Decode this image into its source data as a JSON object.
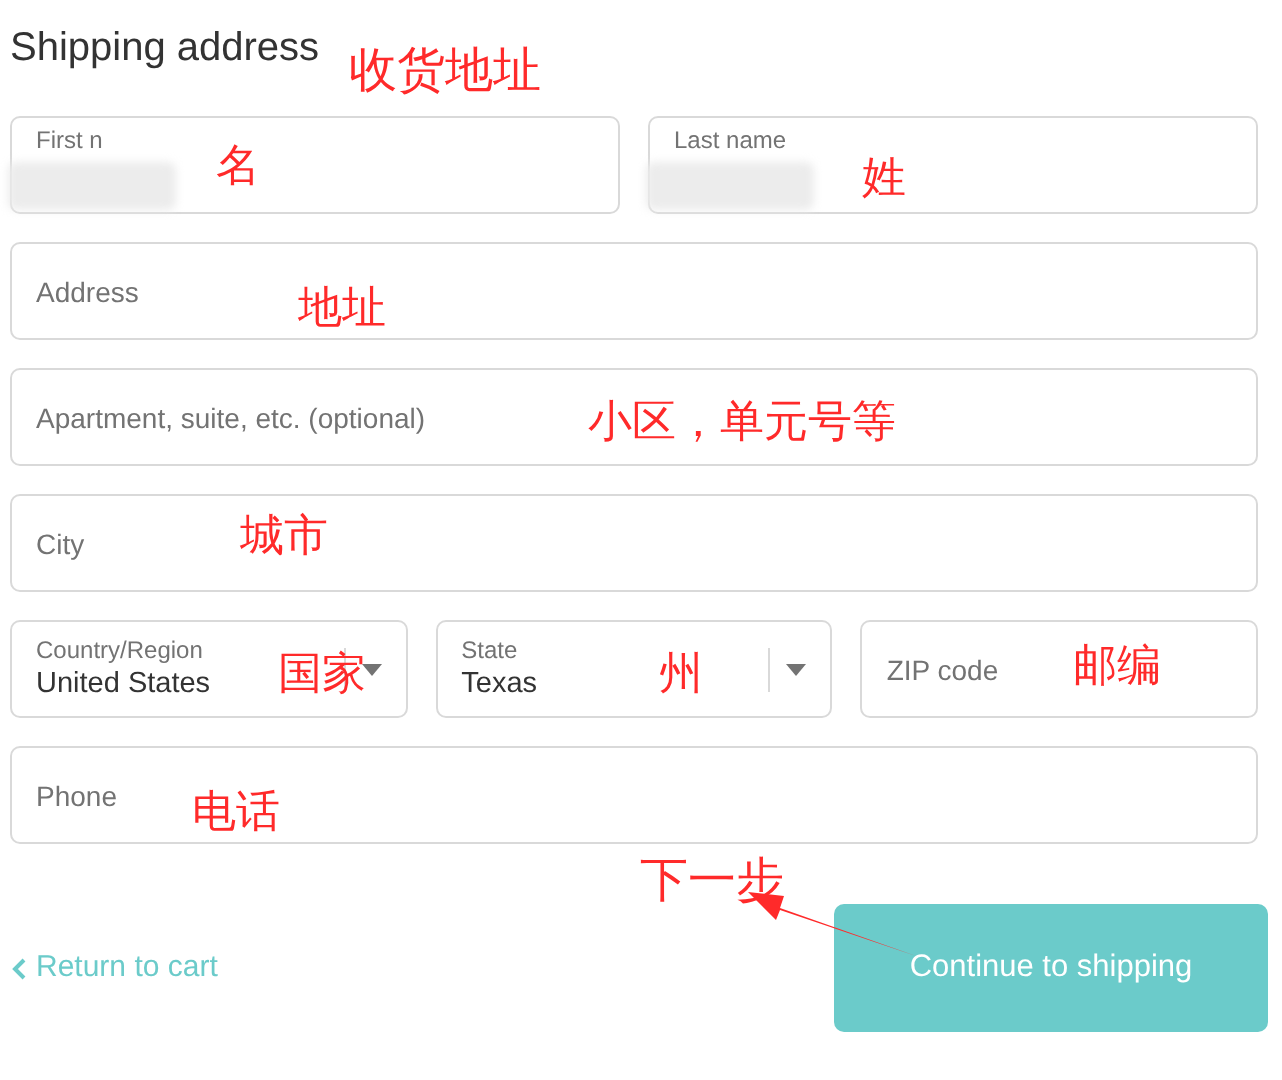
{
  "title": "Shipping address",
  "title_note": "收货地址",
  "rows": [
    [
      {
        "kind": "redacted",
        "label": "First n",
        "note": "名"
      },
      {
        "kind": "redacted",
        "label": "Last name",
        "note": "姓"
      }
    ],
    [
      {
        "kind": "input",
        "placeholder": "Address",
        "note": "地址"
      }
    ],
    [
      {
        "kind": "input",
        "placeholder": "Apartment, suite, etc. (optional)",
        "note": "小区，单元号等"
      }
    ],
    [
      {
        "kind": "input",
        "placeholder": "City",
        "note": "城市"
      }
    ],
    [
      {
        "kind": "select",
        "label": "Country/Region",
        "value": "United States",
        "note": "国家"
      },
      {
        "kind": "select",
        "label": "State",
        "value": "Texas",
        "note": "州"
      },
      {
        "kind": "input",
        "placeholder": "ZIP code",
        "note": "邮编"
      }
    ],
    [
      {
        "kind": "input",
        "placeholder": "Phone",
        "note": "电话"
      }
    ]
  ],
  "back_link": "Return to cart",
  "continue_button": "Continue to shipping",
  "button_note": "下一步"
}
